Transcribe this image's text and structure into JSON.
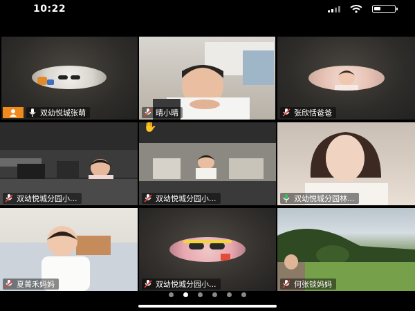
{
  "status_bar": {
    "time": "10:22",
    "battery_level": 0.35
  },
  "tiles": [
    {
      "name": "双幼悦城张萌",
      "host": true,
      "active": true
    },
    {
      "name": "晴小晴"
    },
    {
      "name": "张欣恬爸爸"
    },
    {
      "name": "双幼悦城分园小...",
      "hand_raised": true
    },
    {
      "name": "双幼悦城分园小..."
    },
    {
      "name": "双幼悦城分园林..."
    },
    {
      "name": "夏菁禾妈妈"
    },
    {
      "name": "双幼悦城分园小..."
    },
    {
      "name": "何张锬妈妈"
    }
  ],
  "pager": {
    "pages": 6,
    "current": 2
  },
  "colors": {
    "active_border": "#35c45a",
    "host_badge": "#f08a1c",
    "mic_on": "#35c45a"
  }
}
